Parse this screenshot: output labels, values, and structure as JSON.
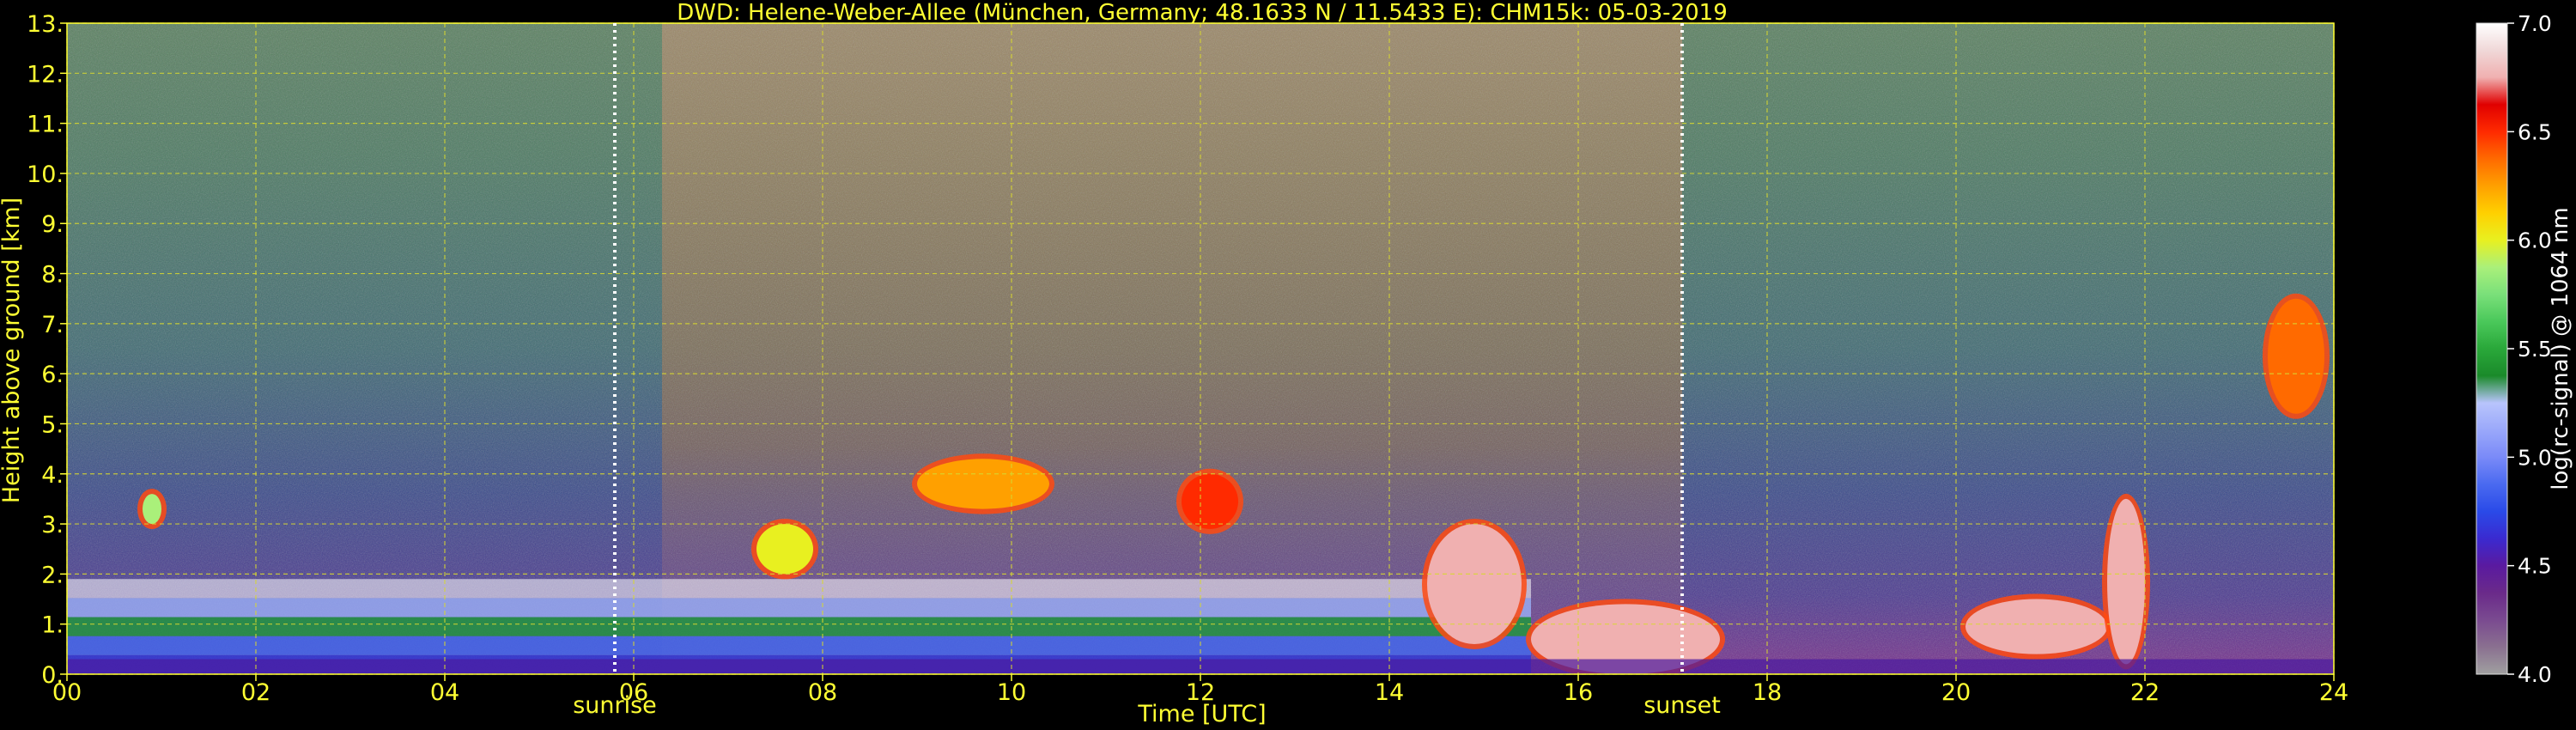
{
  "chart_data": {
    "type": "heatmap",
    "title": "DWD: Helene-Weber-Allee (München, Germany; 48.1633 N / 11.5433 E):    CHM15k: 05-03-2019",
    "xlabel": "Time [UTC]",
    "ylabel": "Height above ground [km]",
    "xlim": [
      0,
      24
    ],
    "ylim": [
      0,
      13
    ],
    "x_ticks": [
      "00",
      "02",
      "04",
      "06",
      "08",
      "10",
      "12",
      "14",
      "16",
      "18",
      "20",
      "22",
      "24"
    ],
    "y_ticks": [
      "0.",
      "1.",
      "2.",
      "3.",
      "4.",
      "5.",
      "6.",
      "7.",
      "8.",
      "9.",
      "10.",
      "11.",
      "12.",
      "13."
    ],
    "grid": true,
    "markers": [
      {
        "label": "sunrise",
        "x": 5.8
      },
      {
        "label": "sunset",
        "x": 17.1
      }
    ],
    "colorbar": {
      "label": "log(rc-signal) @ 1064 nm",
      "range": [
        4.0,
        7.0
      ],
      "ticks": [
        "4.0",
        "4.5",
        "5.0",
        "5.5",
        "6.0",
        "6.5",
        "7.0"
      ],
      "colors": [
        "#a0a0a0",
        "#8a7090",
        "#7a4a90",
        "#6a2a8a",
        "#5a1aa0",
        "#3a2ad0",
        "#2a4ae8",
        "#4a6af0",
        "#7a8af8",
        "#9aa8fa",
        "#b8c4fc",
        "#1a8a2a",
        "#2aa83a",
        "#4ac85a",
        "#7ae07a",
        "#aaf07a",
        "#e8f020",
        "#ffd000",
        "#ffa000",
        "#ff6a00",
        "#ff2a00",
        "#e00000",
        "#f0b0b0",
        "#f0d8d8",
        "#ffffff"
      ]
    },
    "layers": [
      {
        "name": "boundary layer",
        "x": [
          0,
          15.5
        ],
        "y": [
          0.0,
          1.9
        ],
        "level": 5.2
      },
      {
        "name": "low cloud base",
        "x": [
          15.5,
          17.5
        ],
        "y": [
          0.0,
          1.4
        ],
        "level": 6.8
      },
      {
        "name": "cloud",
        "x": [
          14.4,
          15.4
        ],
        "y": [
          0.6,
          3.0
        ],
        "level": 6.7
      },
      {
        "name": "cloud",
        "x": [
          9.0,
          10.4
        ],
        "y": [
          3.3,
          4.3
        ],
        "level": 6.2
      },
      {
        "name": "cloud",
        "x": [
          11.8,
          12.4
        ],
        "y": [
          2.9,
          4.0
        ],
        "level": 6.5
      },
      {
        "name": "cloud",
        "x": [
          20.1,
          21.6
        ],
        "y": [
          0.4,
          1.5
        ],
        "level": 6.8
      },
      {
        "name": "cloud",
        "x": [
          21.6,
          22.0
        ],
        "y": [
          0.2,
          3.5
        ],
        "level": 6.7
      },
      {
        "name": "cloud",
        "x": [
          23.3,
          23.9
        ],
        "y": [
          5.2,
          7.5
        ],
        "level": 6.4
      },
      {
        "name": "cloud",
        "x": [
          7.3,
          7.9
        ],
        "y": [
          2.0,
          3.0
        ],
        "level": 6.0
      },
      {
        "name": "cloud",
        "x": [
          0.8,
          1.0
        ],
        "y": [
          3.0,
          3.6
        ],
        "level": 5.9
      }
    ]
  }
}
